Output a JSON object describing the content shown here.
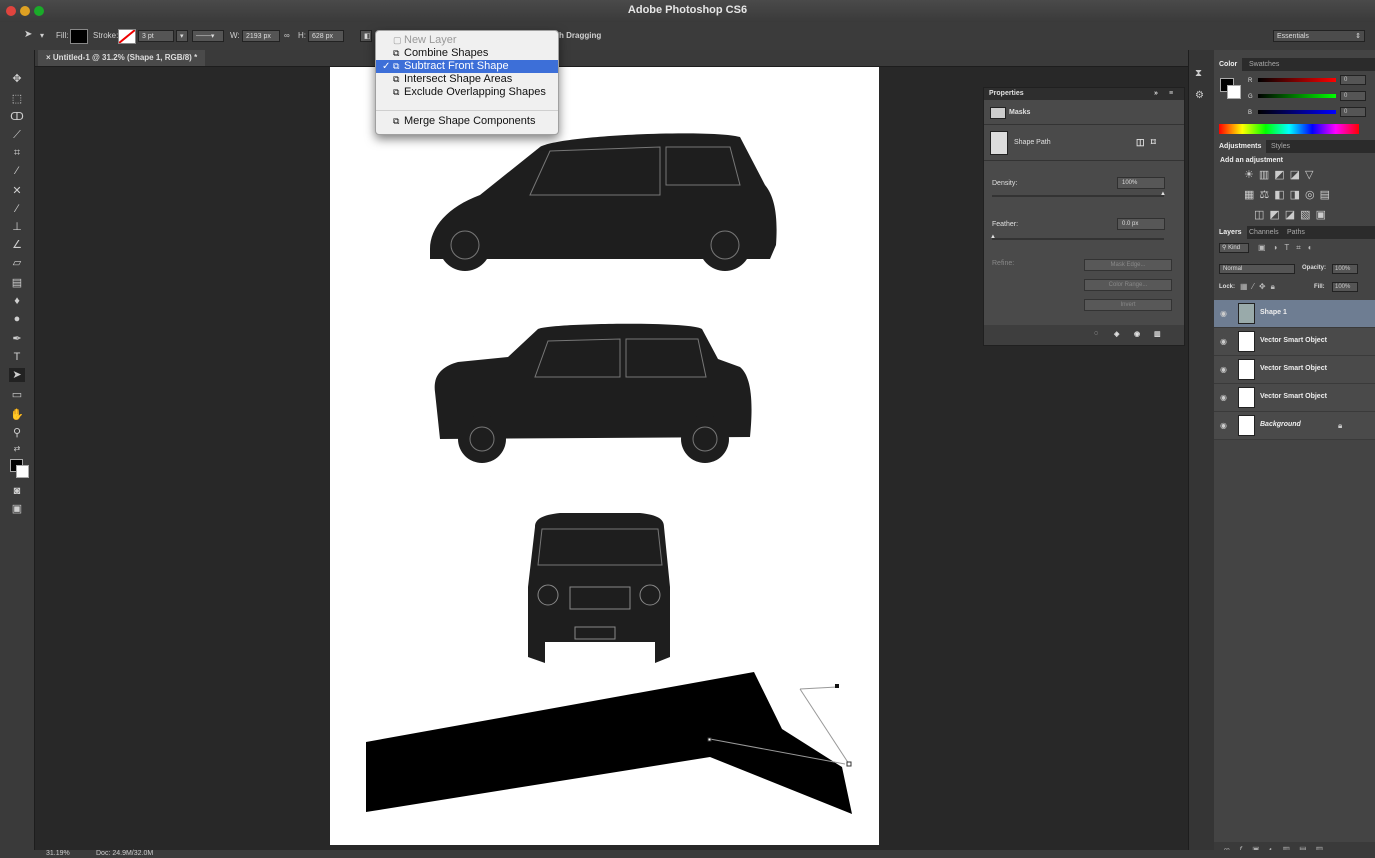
{
  "app": {
    "title": "Adobe Photoshop CS6"
  },
  "options_bar": {
    "fill_label": "Fill:",
    "stroke_label": "Stroke:",
    "stroke_width": "3 pt",
    "w_label": "W:",
    "w_value": "2193 px",
    "h_label": "H:",
    "h_value": "628 px",
    "align_edges_label": "h Dragging",
    "workspace": "Essentials"
  },
  "document_tab": {
    "label": "Untitled-1 @ 31.2% (Shape 1, RGB/8) *"
  },
  "path_ops_menu": {
    "items": [
      {
        "label": "New Layer",
        "state": "disabled"
      },
      {
        "label": "Combine Shapes",
        "state": "normal"
      },
      {
        "label": "Subtract Front Shape",
        "state": "selected"
      },
      {
        "label": "Intersect Shape Areas",
        "state": "normal"
      },
      {
        "label": "Exclude Overlapping Shapes",
        "state": "normal"
      },
      {
        "label": "Merge Shape Components",
        "state": "normal"
      }
    ]
  },
  "properties": {
    "title": "Properties",
    "section": "Masks",
    "shape_path": "Shape Path",
    "density_label": "Density:",
    "density_value": "100%",
    "feather_label": "Feather:",
    "feather_value": "0.0 px",
    "refine_label": "Refine:",
    "mask_edge": "Mask Edge...",
    "color_range": "Color Range...",
    "invert": "Invert"
  },
  "color_panel": {
    "tabs": [
      "Color",
      "Swatches"
    ],
    "r_label": "R",
    "r_value": "0",
    "g_label": "G",
    "g_value": "0",
    "b_label": "B",
    "b_value": "0"
  },
  "adjustments": {
    "tabs": [
      "Adjustments",
      "Styles"
    ],
    "heading": "Add an adjustment"
  },
  "layers_panel": {
    "tabs": [
      "Layers",
      "Channels",
      "Paths"
    ],
    "kind": "Kind",
    "blend_mode": "Normal",
    "opacity_label": "Opacity:",
    "opacity_value": "100%",
    "lock_label": "Lock:",
    "fill_label": "Fill:",
    "fill_value": "100%",
    "layers": [
      {
        "name": "Shape 1",
        "selected": true
      },
      {
        "name": "Vector Smart Object",
        "selected": false
      },
      {
        "name": "Vector Smart Object",
        "selected": false
      },
      {
        "name": "Vector Smart Object",
        "selected": false
      },
      {
        "name": "Background",
        "selected": false
      }
    ]
  },
  "status": {
    "zoom": "31.19%",
    "doc": "Doc: 24.9M/32.0M"
  }
}
